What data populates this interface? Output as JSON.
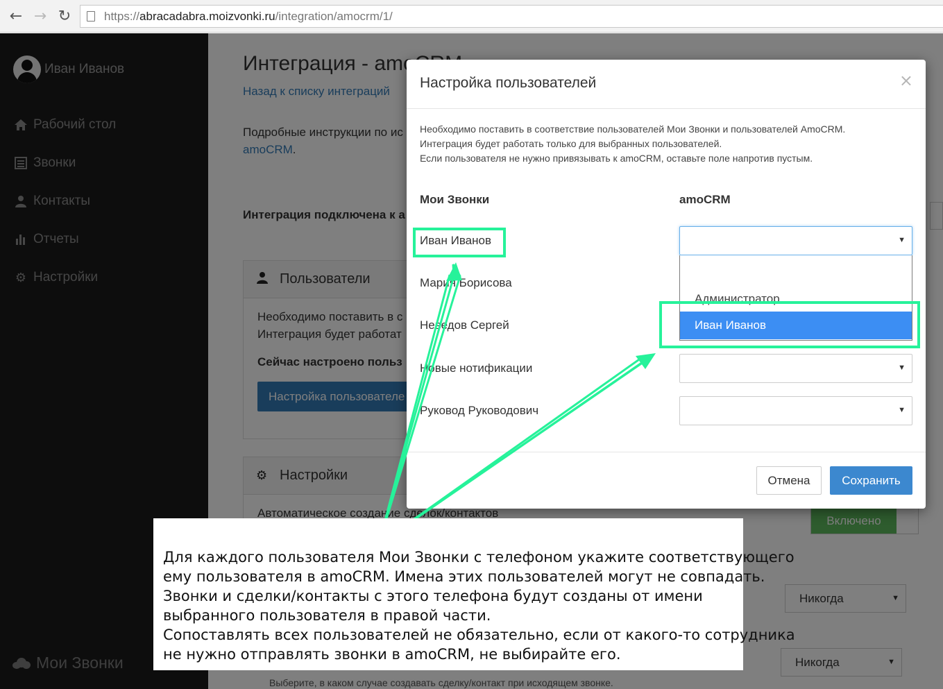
{
  "browser": {
    "url_scheme": "https://",
    "url_host": "abracadabra.moizvonki.ru",
    "url_path": "/integration/amocrm/1/"
  },
  "sidebar": {
    "user_name": "Иван Иванов",
    "items": [
      {
        "label": "Рабочий стол",
        "icon": "home-icon"
      },
      {
        "label": "Звонки",
        "icon": "list-icon"
      },
      {
        "label": "Контакты",
        "icon": "user-icon"
      },
      {
        "label": "Отчеты",
        "icon": "bar-chart-icon"
      },
      {
        "label": "Настройки",
        "icon": "gear-icon"
      }
    ],
    "brand": "Мои Звонки"
  },
  "main": {
    "title": "Интеграция - amoCRM",
    "back_link": "Назад к списку интеграций",
    "instructions_line1": "Подробные инструкции по ис",
    "instructions_link": "amoCRM",
    "instructions_end": ".",
    "connected": "Интеграция подключена к а",
    "users_panel": {
      "title": "Пользователи",
      "line1": "Необходимо поставить в с",
      "line2": "Интеграция будет работат",
      "line3": "Сейчас настроено польз",
      "button": "Настройка пользователе"
    },
    "settings_panel": {
      "title": "Настройки",
      "line1": "Автоматическое создание сделок/контактов"
    },
    "toggle_on": "Включено",
    "never_1": "Никогда",
    "never_2": "Никогда",
    "footer_note": "Выберите, в каком случае создавать сделку/контакт при исходящем звонке."
  },
  "modal": {
    "title": "Настройка пользователей",
    "close": "×",
    "desc_line1": "Необходимо поставить в соответствие пользователей Мои Звонки и пользователей AmoCRM.",
    "desc_line2": "Интеграция будет работать только для выбранных пользователей.",
    "desc_line3": "Если пользователя не нужно привязывать к amoCRM, оставьте поле напротив пустым.",
    "col_left": "Мои Звонки",
    "col_right": "amoCRM",
    "rows": [
      {
        "name": "Иван Иванов",
        "selected": ""
      },
      {
        "name": "Мария Борисова",
        "selected": ""
      },
      {
        "name": "Неведов Сергей",
        "selected": ""
      },
      {
        "name": "Новые нотификации",
        "selected": ""
      },
      {
        "name": "Руковод Руководович",
        "selected": ""
      }
    ],
    "dropdown_options": [
      "",
      "Администратор",
      "Иван Иванов"
    ],
    "dropdown_highlighted": "Иван Иванов",
    "cancel": "Отмена",
    "save": "Сохранить"
  },
  "callout": {
    "line1": "Для каждого пользователя Мои Звонки с телефоном укажите соответствующего",
    "line2": "ему пользователя в amoCRM. Имена этих пользователей могут не совпадать.",
    "line3": "Звонки и сделки/контакты с этого телефона будут созданы от имени",
    "line4": "выбранного пользователя в правой части.",
    "line5": "Сопоставлять всех пользователей не обязательно, если от какого-то сотрудника",
    "line6": "не нужно отправлять звонки в amoCRM, не выбирайте его."
  },
  "colors": {
    "sidebar_bg": "#1a1a1a",
    "link": "#337ab7",
    "primary_button": "#3c88cf",
    "highlight_option": "#3c8ef3",
    "annotation_green": "#26f29a",
    "toggle_green": "#5cb85c"
  }
}
